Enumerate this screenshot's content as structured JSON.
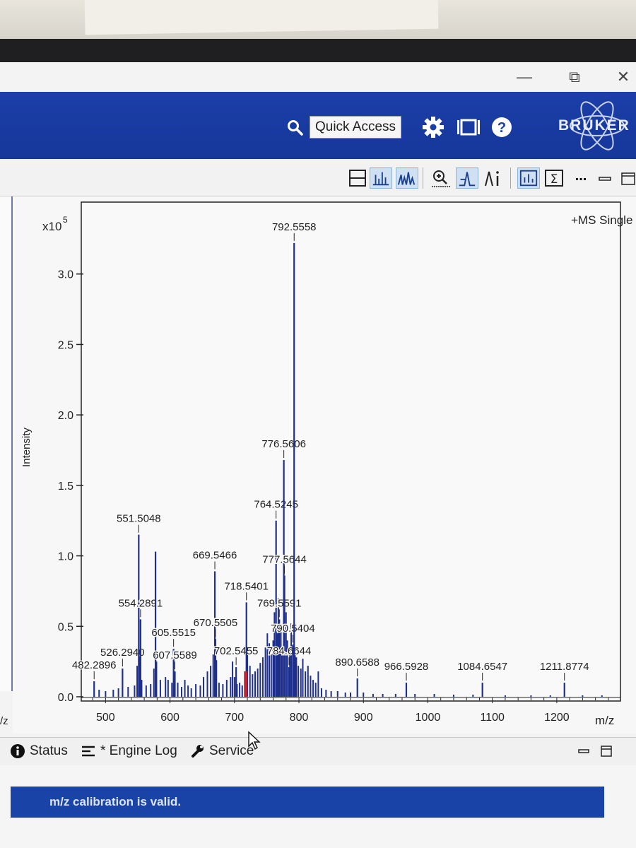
{
  "window": {
    "minimize_glyph": "—",
    "restore_glyph": "⧉",
    "close_glyph": "✕"
  },
  "header": {
    "quick_access_label": "Quick Access",
    "brand": "BRUKER",
    "icons": [
      "search-icon",
      "gear-icon",
      "layout-icon",
      "help-icon"
    ],
    "colors": {
      "header_blue": "#1b3fa8",
      "message_blue": "#1a43a8",
      "peak_blue": "#1f2f8c"
    }
  },
  "toolbar": {
    "icons": [
      "split-view-icon",
      "line-spectrum-icon",
      "profile-spectrum-icon",
      "zoom-icon",
      "peak-pick-icon",
      "annotation-icon",
      "bar-view-icon",
      "sum-icon",
      "more-icon",
      "minimize-icon",
      "maximize-icon"
    ],
    "more_label": "..."
  },
  "chart_data": {
    "type": "bar",
    "title": "+MS Single",
    "ylabel": "Intensity",
    "xlabel": "m/z",
    "y_multiplier": "x10",
    "y_exponent": "5",
    "xlim": [
      470,
      1290
    ],
    "ylim": [
      0,
      3.45
    ],
    "y_ticks": [
      0.0,
      0.5,
      1.0,
      1.5,
      2.0,
      2.5,
      3.0
    ],
    "y_tick_labels": [
      "0.0",
      "0.5",
      "1.0",
      "1.5",
      "2.0",
      "2.5",
      "3.0"
    ],
    "x_ticks": [
      500,
      600,
      700,
      800,
      900,
      1000,
      1100,
      1200
    ],
    "x_tick_labels": [
      "500",
      "600",
      "700",
      "800",
      "900",
      "1000",
      "1100",
      "1200"
    ],
    "grid": false,
    "peaks": [
      {
        "mz": 482.2896,
        "intensity": 0.11,
        "label": "482.2896"
      },
      {
        "mz": 526.294,
        "intensity": 0.2,
        "label": "526.2940"
      },
      {
        "mz": 551.5048,
        "intensity": 1.15,
        "label": "551.5048"
      },
      {
        "mz": 554.2891,
        "intensity": 0.55,
        "label": "554.2891"
      },
      {
        "mz": 577.5,
        "intensity": 1.03,
        "label": ""
      },
      {
        "mz": 605.5515,
        "intensity": 0.34,
        "label": "605.5515"
      },
      {
        "mz": 607.5589,
        "intensity": 0.18,
        "label": "607.5589"
      },
      {
        "mz": 669.5466,
        "intensity": 0.89,
        "label": "669.5466"
      },
      {
        "mz": 670.5505,
        "intensity": 0.41,
        "label": "670.5505"
      },
      {
        "mz": 702.5455,
        "intensity": 0.21,
        "label": "702.5455"
      },
      {
        "mz": 718.5401,
        "intensity": 0.67,
        "label": "718.5401"
      },
      {
        "mz": 764.5245,
        "intensity": 1.25,
        "label": "764.5245"
      },
      {
        "mz": 769.5591,
        "intensity": 0.55,
        "label": "769.5591"
      },
      {
        "mz": 776.5606,
        "intensity": 1.68,
        "label": "776.5606"
      },
      {
        "mz": 777.5644,
        "intensity": 0.86,
        "label": "777.5644"
      },
      {
        "mz": 784.6644,
        "intensity": 0.21,
        "label": "784.6644"
      },
      {
        "mz": 790.5404,
        "intensity": 0.37,
        "label": "790.5404"
      },
      {
        "mz": 792.5558,
        "intensity": 3.22,
        "label": "792.5558"
      },
      {
        "mz": 890.6588,
        "intensity": 0.13,
        "label": "890.6588"
      },
      {
        "mz": 966.5928,
        "intensity": 0.1,
        "label": "966.5928"
      },
      {
        "mz": 1084.6547,
        "intensity": 0.1,
        "label": "1084.6547"
      },
      {
        "mz": 1211.8774,
        "intensity": 0.1,
        "label": "1211.8774"
      }
    ],
    "minor_peaks": [
      {
        "mz": 490,
        "intensity": 0.05
      },
      {
        "mz": 500,
        "intensity": 0.04
      },
      {
        "mz": 512,
        "intensity": 0.05
      },
      {
        "mz": 520,
        "intensity": 0.06
      },
      {
        "mz": 535,
        "intensity": 0.07
      },
      {
        "mz": 545,
        "intensity": 0.08
      },
      {
        "mz": 549,
        "intensity": 0.22
      },
      {
        "mz": 552.5,
        "intensity": 0.3
      },
      {
        "mz": 556,
        "intensity": 0.12
      },
      {
        "mz": 563,
        "intensity": 0.08
      },
      {
        "mz": 570,
        "intensity": 0.09
      },
      {
        "mz": 575,
        "intensity": 0.2
      },
      {
        "mz": 579,
        "intensity": 0.25
      },
      {
        "mz": 585,
        "intensity": 0.12
      },
      {
        "mz": 593,
        "intensity": 0.14
      },
      {
        "mz": 597,
        "intensity": 0.12
      },
      {
        "mz": 603,
        "intensity": 0.1
      },
      {
        "mz": 612,
        "intensity": 0.1
      },
      {
        "mz": 618,
        "intensity": 0.07
      },
      {
        "mz": 623,
        "intensity": 0.12
      },
      {
        "mz": 628,
        "intensity": 0.08
      },
      {
        "mz": 633,
        "intensity": 0.06
      },
      {
        "mz": 640,
        "intensity": 0.09
      },
      {
        "mz": 647,
        "intensity": 0.08
      },
      {
        "mz": 652,
        "intensity": 0.14
      },
      {
        "mz": 658,
        "intensity": 0.18
      },
      {
        "mz": 663,
        "intensity": 0.22
      },
      {
        "mz": 667,
        "intensity": 0.3
      },
      {
        "mz": 672,
        "intensity": 0.26
      },
      {
        "mz": 676,
        "intensity": 0.1
      },
      {
        "mz": 682,
        "intensity": 0.09
      },
      {
        "mz": 688,
        "intensity": 0.12
      },
      {
        "mz": 694,
        "intensity": 0.14
      },
      {
        "mz": 697,
        "intensity": 0.25
      },
      {
        "mz": 700,
        "intensity": 0.14
      },
      {
        "mz": 704,
        "intensity": 0.09
      },
      {
        "mz": 708,
        "intensity": 0.1
      },
      {
        "mz": 712,
        "intensity": 0.08
      },
      {
        "mz": 716,
        "intensity": 0.18
      },
      {
        "mz": 720,
        "intensity": 0.3
      },
      {
        "mz": 724,
        "intensity": 0.22
      },
      {
        "mz": 728,
        "intensity": 0.16
      },
      {
        "mz": 732,
        "intensity": 0.18
      },
      {
        "mz": 736,
        "intensity": 0.2
      },
      {
        "mz": 740,
        "intensity": 0.24
      },
      {
        "mz": 744,
        "intensity": 0.28
      },
      {
        "mz": 748,
        "intensity": 0.35
      },
      {
        "mz": 751,
        "intensity": 0.45
      },
      {
        "mz": 754,
        "intensity": 0.38
      },
      {
        "mz": 757,
        "intensity": 0.3
      },
      {
        "mz": 760,
        "intensity": 0.4
      },
      {
        "mz": 762,
        "intensity": 0.6
      },
      {
        "mz": 766,
        "intensity": 0.45
      },
      {
        "mz": 768,
        "intensity": 0.7
      },
      {
        "mz": 772,
        "intensity": 0.48
      },
      {
        "mz": 774,
        "intensity": 0.35
      },
      {
        "mz": 780,
        "intensity": 0.6
      },
      {
        "mz": 782,
        "intensity": 0.4
      },
      {
        "mz": 786,
        "intensity": 0.3
      },
      {
        "mz": 788,
        "intensity": 0.52
      },
      {
        "mz": 794,
        "intensity": 0.35
      },
      {
        "mz": 796,
        "intensity": 0.28
      },
      {
        "mz": 799,
        "intensity": 0.22
      },
      {
        "mz": 803,
        "intensity": 0.2
      },
      {
        "mz": 806,
        "intensity": 0.27
      },
      {
        "mz": 810,
        "intensity": 0.18
      },
      {
        "mz": 814,
        "intensity": 0.22
      },
      {
        "mz": 818,
        "intensity": 0.15
      },
      {
        "mz": 822,
        "intensity": 0.12
      },
      {
        "mz": 826,
        "intensity": 0.1
      },
      {
        "mz": 830,
        "intensity": 0.18
      },
      {
        "mz": 835,
        "intensity": 0.06
      },
      {
        "mz": 842,
        "intensity": 0.05
      },
      {
        "mz": 850,
        "intensity": 0.04
      },
      {
        "mz": 860,
        "intensity": 0.04
      },
      {
        "mz": 872,
        "intensity": 0.03
      },
      {
        "mz": 880,
        "intensity": 0.03
      },
      {
        "mz": 900,
        "intensity": 0.03
      },
      {
        "mz": 915,
        "intensity": 0.02
      },
      {
        "mz": 930,
        "intensity": 0.02
      },
      {
        "mz": 950,
        "intensity": 0.02
      },
      {
        "mz": 980,
        "intensity": 0.02
      },
      {
        "mz": 1010,
        "intensity": 0.02
      },
      {
        "mz": 1040,
        "intensity": 0.015
      },
      {
        "mz": 1070,
        "intensity": 0.015
      },
      {
        "mz": 1120,
        "intensity": 0.01
      },
      {
        "mz": 1160,
        "intensity": 0.01
      },
      {
        "mz": 1190,
        "intensity": 0.01
      },
      {
        "mz": 1240,
        "intensity": 0.01
      },
      {
        "mz": 1270,
        "intensity": 0.01
      }
    ],
    "peak_color": "#1f2f8c",
    "marker_color": "#d02020"
  },
  "axis_left_fragment": "/z",
  "dock": {
    "tabs": [
      {
        "icon": "info-icon",
        "label": "Status"
      },
      {
        "icon": "list-icon",
        "label": "* Engine Log"
      },
      {
        "icon": "wrench-icon",
        "label": "Service"
      }
    ],
    "message": "m/z calibration is valid."
  }
}
